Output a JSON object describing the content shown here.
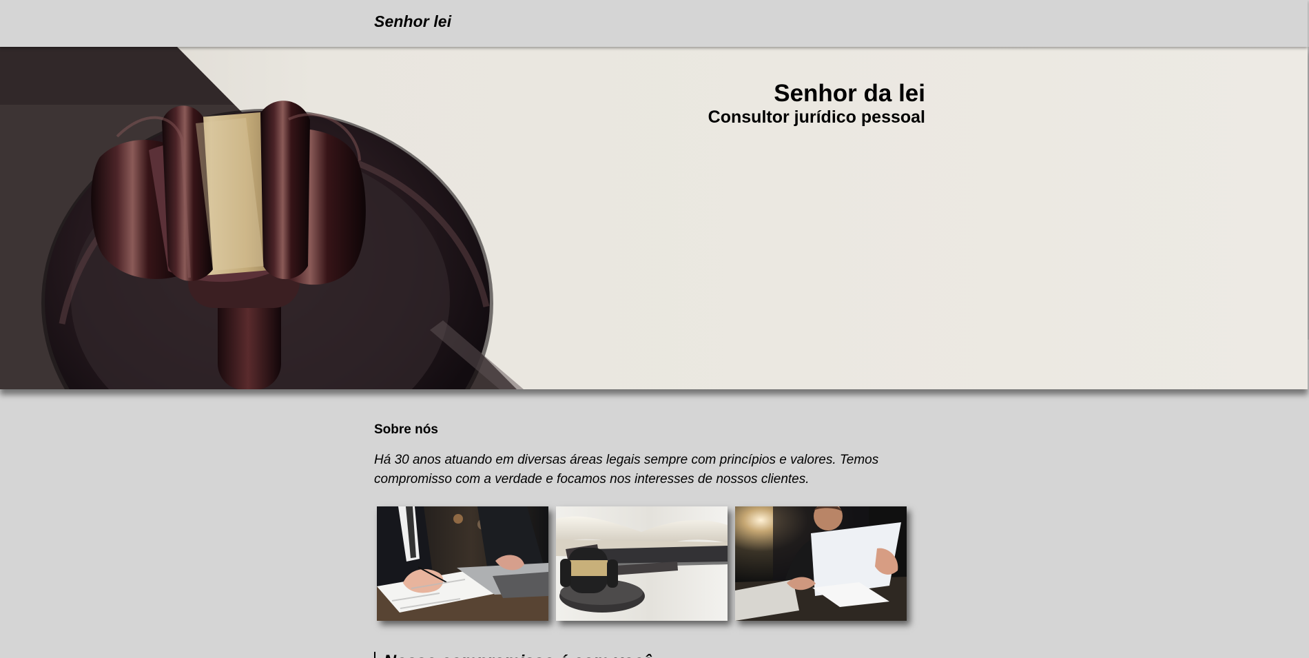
{
  "header": {
    "brand": "Senhor lei"
  },
  "hero": {
    "title": "Senhor da lei",
    "subtitle": "Consultor jurídico pessoal",
    "image_icon": "gavel-image"
  },
  "about": {
    "title": "Sobre nós",
    "text": "Há 30 anos atuando em diversas áreas legais sempre com princípios e valores. Temos compromisso com a verdade e focamos nos interesses de nossos clientes."
  },
  "gallery": {
    "images": [
      {
        "name": "lawyers-signing-document-image"
      },
      {
        "name": "gavel-and-books-image"
      },
      {
        "name": "man-reading-document-image"
      }
    ]
  },
  "commitment": {
    "heading": "Nosso compromisso é com você"
  },
  "colors": {
    "page_background": "#d5d5d5",
    "text": "#000000",
    "hero_background": "#ebe8e1",
    "gavel_dark": "#2b1719",
    "gavel_gold": "#c9b58a"
  }
}
